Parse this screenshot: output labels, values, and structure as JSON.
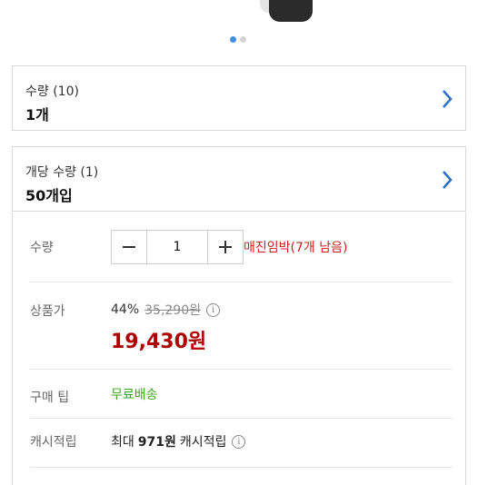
{
  "carousel": {
    "active_index": 0,
    "total": 2
  },
  "options": [
    {
      "label": "수량 (10)",
      "value": "1개"
    },
    {
      "label": "개당 수량 (1)",
      "value": "50개입"
    }
  ],
  "quantity": {
    "label": "수량",
    "value": "1",
    "stock_warning": "매진임박(7개 남음)"
  },
  "price": {
    "label": "상품가",
    "discount_rate": "44%",
    "original_price": "35,290원",
    "sale_price": "19,430원"
  },
  "tip": {
    "label": "구매 팁",
    "value": "무료배송"
  },
  "cash": {
    "label": "캐시적립",
    "prefix": "최대",
    "amount": "971원",
    "suffix": "캐시적립"
  },
  "colors": {
    "accent": "#3f8fe6",
    "sale": "#ae0000",
    "warning": "#cc1f1f",
    "free_shipping": "#3aa61a"
  },
  "icons": {
    "chevron": "chevron-right-icon",
    "info": "info-icon",
    "minus": "minus-icon",
    "plus": "plus-icon"
  }
}
